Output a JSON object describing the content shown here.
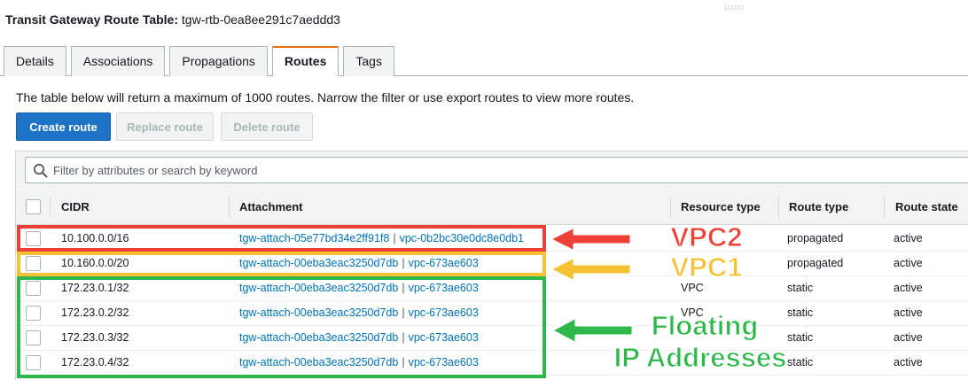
{
  "header": {
    "title_prefix": "Transit Gateway Route Table:",
    "route_table_id": "tgw-rtb-0ea8ee291c7aeddd3",
    "window_dots": "□□□"
  },
  "tabs": [
    {
      "label": "Details",
      "active": false
    },
    {
      "label": "Associations",
      "active": false
    },
    {
      "label": "Propagations",
      "active": false
    },
    {
      "label": "Routes",
      "active": true
    },
    {
      "label": "Tags",
      "active": false
    }
  ],
  "notice": "The table below will return a maximum of 1000 routes. Narrow the filter or use export routes to view more routes.",
  "actions": {
    "create_label": "Create route",
    "replace_label": "Replace route",
    "delete_label": "Delete route"
  },
  "search": {
    "placeholder": "Filter by attributes or search by keyword"
  },
  "columns": {
    "cidr": "CIDR",
    "attachment": "Attachment",
    "resource_type": "Resource type",
    "route_type": "Route type",
    "route_state": "Route state"
  },
  "rows": [
    {
      "cidr": "10.100.0.0/16",
      "attachment_id": "tgw-attach-05e77bd34e2ff91f8",
      "vpc_id": "vpc-0b2bc30e0dc8e0db1",
      "resource_type": "",
      "route_type": "propagated",
      "route_state": "active"
    },
    {
      "cidr": "10.160.0.0/20",
      "attachment_id": "tgw-attach-00eba3eac3250d7db",
      "vpc_id": "vpc-673ae603",
      "resource_type": "",
      "route_type": "propagated",
      "route_state": "active"
    },
    {
      "cidr": "172.23.0.1/32",
      "attachment_id": "tgw-attach-00eba3eac3250d7db",
      "vpc_id": "vpc-673ae603",
      "resource_type": "VPC",
      "route_type": "static",
      "route_state": "active"
    },
    {
      "cidr": "172.23.0.2/32",
      "attachment_id": "tgw-attach-00eba3eac3250d7db",
      "vpc_id": "vpc-673ae603",
      "resource_type": "VPC",
      "route_type": "static",
      "route_state": "active"
    },
    {
      "cidr": "172.23.0.3/32",
      "attachment_id": "tgw-attach-00eba3eac3250d7db",
      "vpc_id": "vpc-673ae603",
      "resource_type": "",
      "route_type": "static",
      "route_state": "active"
    },
    {
      "cidr": "172.23.0.4/32",
      "attachment_id": "tgw-attach-00eba3eac3250d7db",
      "vpc_id": "vpc-673ae603",
      "resource_type": "",
      "route_type": "static",
      "route_state": "active"
    }
  ],
  "annotations": {
    "vpc2": {
      "text": "VPC2",
      "color": "#ee4036"
    },
    "vpc1": {
      "text": "VPC1",
      "color": "#f6c234"
    },
    "floating": {
      "line1": "Floating",
      "line2": "IP Addresses",
      "color": "#2eb84b"
    }
  },
  "colors": {
    "accent_tab": "#ec7211",
    "primary_button": "#1f73c7",
    "link": "#0073bb"
  }
}
